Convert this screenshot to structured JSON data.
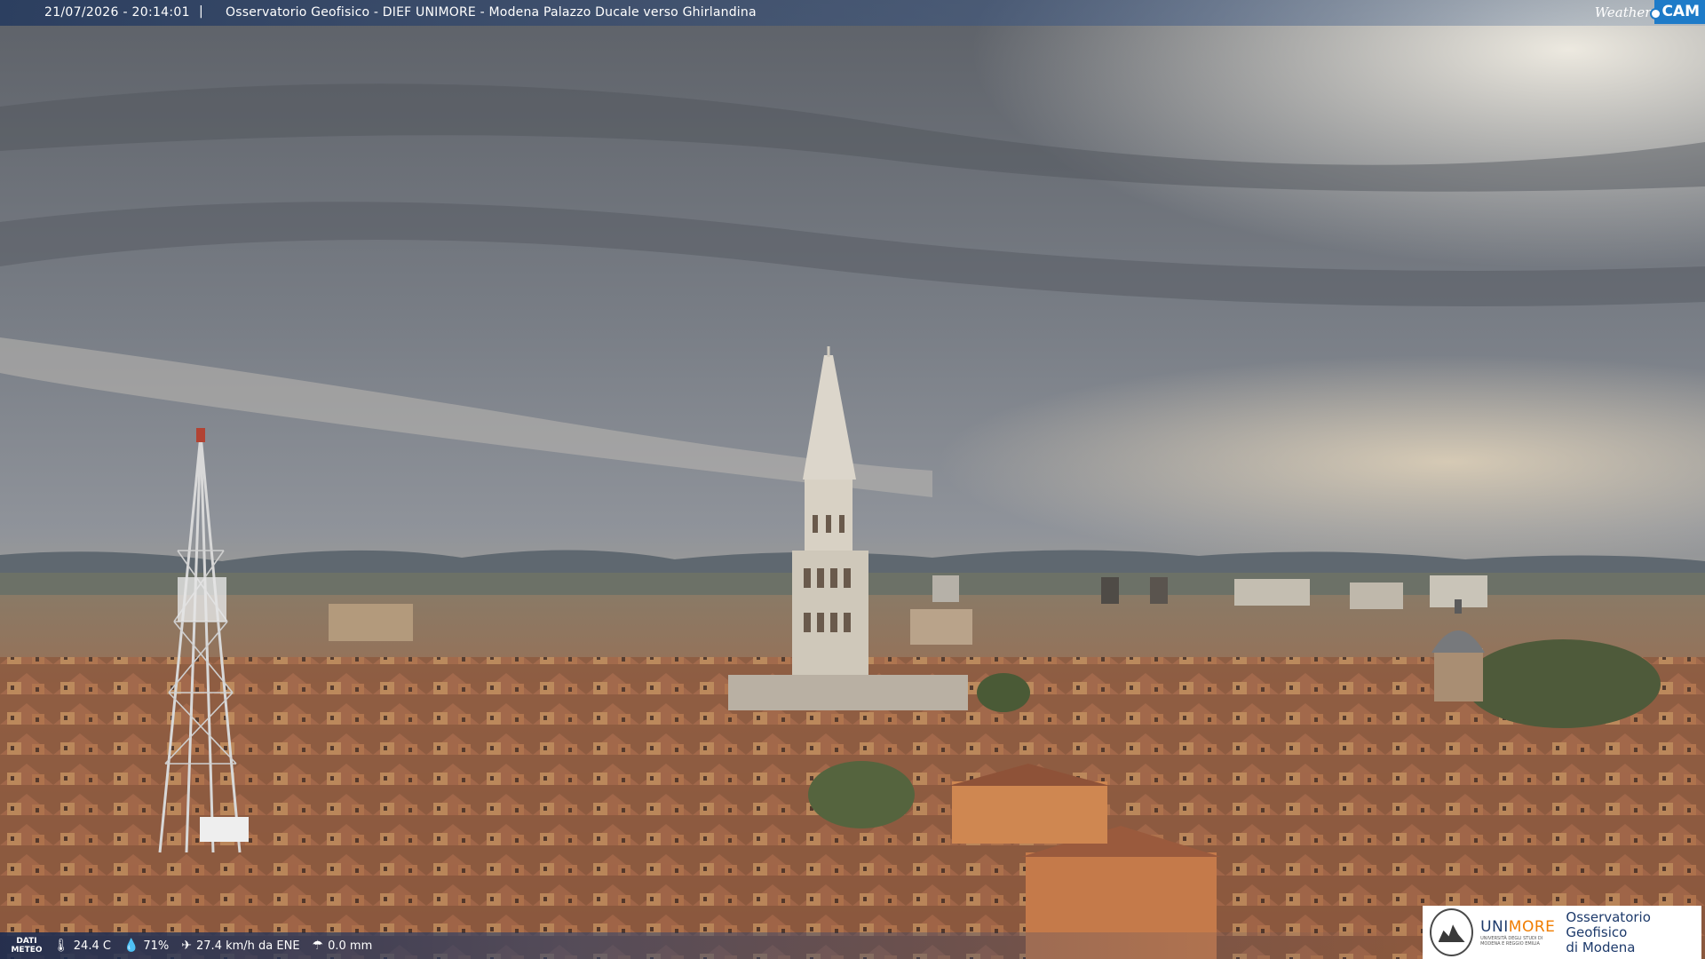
{
  "header": {
    "timestamp": "21/07/2026 - 20:14:01",
    "separator": "|",
    "title": "Osservatorio Geofisico - DIEF UNIMORE - Modena Palazzo Ducale verso Ghirlandina",
    "logo_weather": "Weather",
    "logo_cam": "CAM"
  },
  "footer": {
    "dati_label_1": "DATI",
    "dati_label_2": "METEO",
    "temperature": "24.4 C",
    "humidity": "71%",
    "wind": "27.4 km/h da ENE",
    "rain": "0.0 mm",
    "icons": [
      "thermometer-icon",
      "humidity-drop-icon",
      "wind-icon",
      "rain-icon"
    ]
  },
  "branding": {
    "uni_name_part1": "UNI",
    "uni_name_part2": "MORE",
    "uni_sub": "UNIVERSITÀ DEGLI STUDI DI MODENA E REGGIO EMILIA",
    "observatory_line1": "Osservatorio Geofisico",
    "observatory_line2": "di Modena"
  },
  "colors": {
    "accent": "#1e7bc8",
    "unimore_blue": "#1d3a6b",
    "unimore_orange": "#f07d00"
  }
}
